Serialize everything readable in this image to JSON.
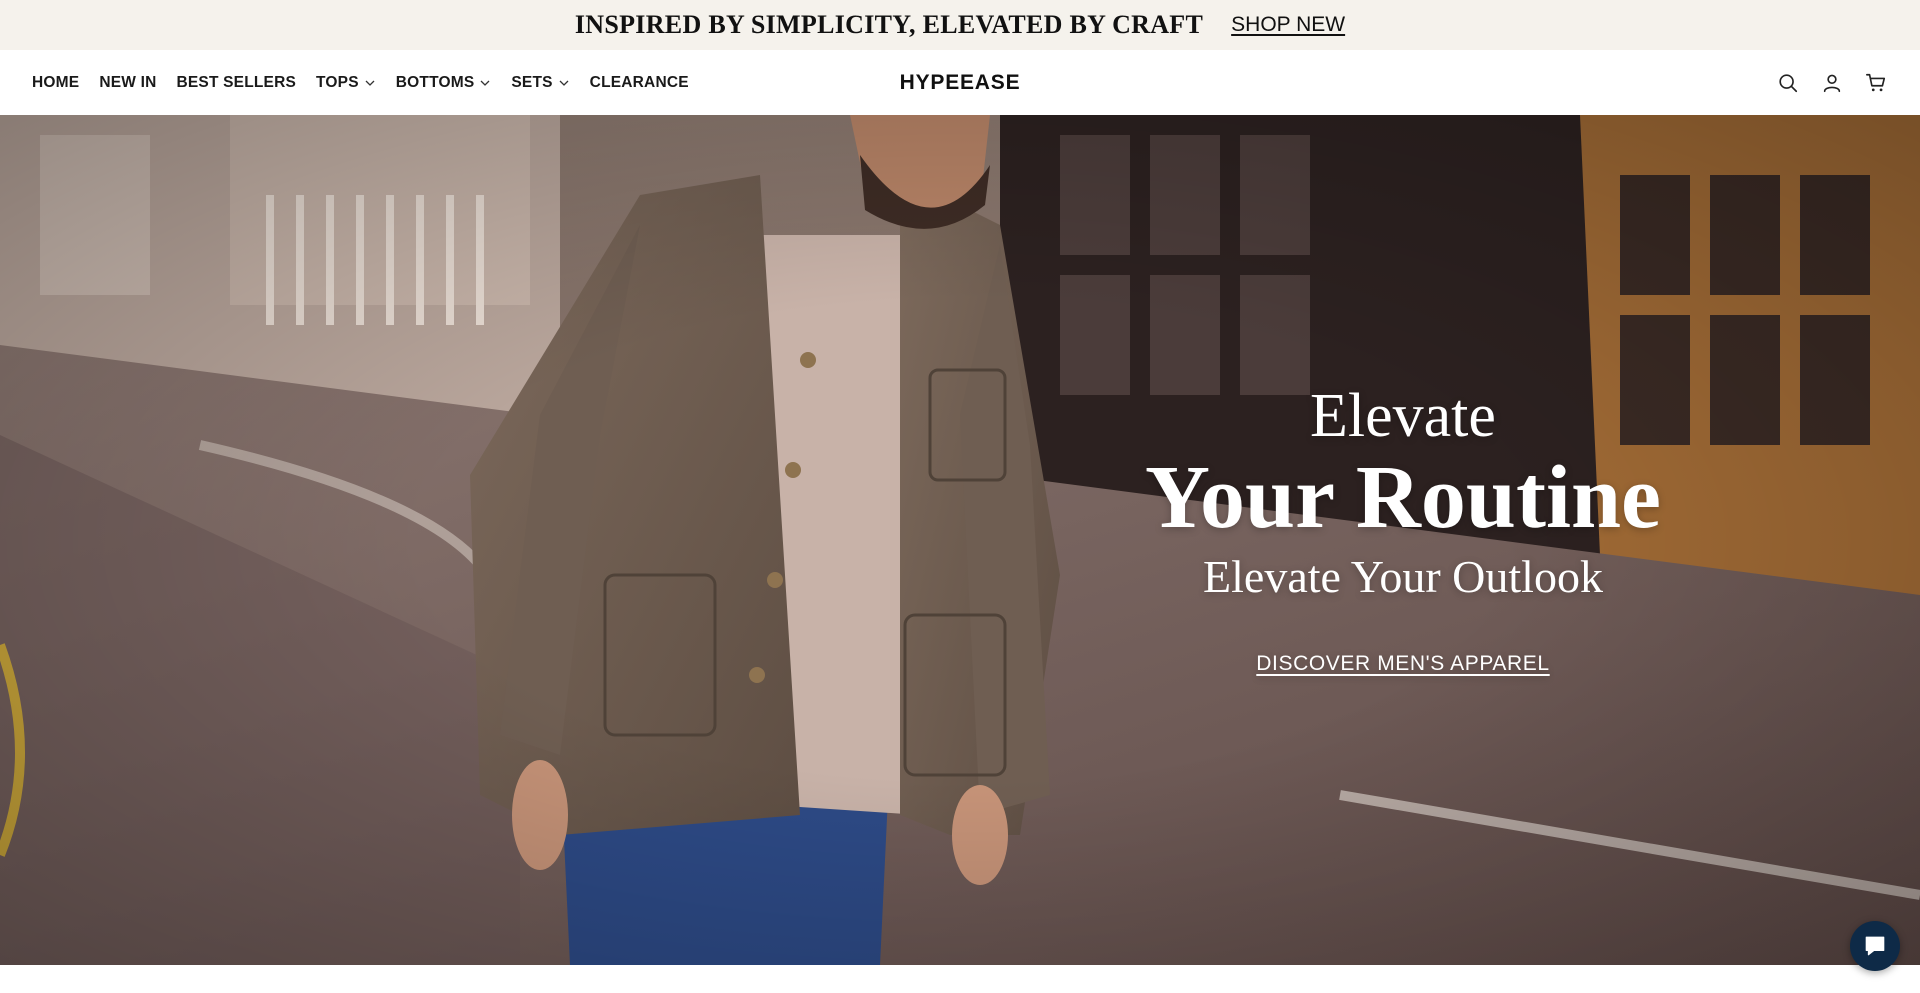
{
  "announcement": {
    "text": "INSPIRED BY SIMPLICITY, ELEVATED BY CRAFT",
    "link_label": "SHOP NEW"
  },
  "nav": {
    "items": [
      {
        "label": "HOME",
        "has_dropdown": false
      },
      {
        "label": "NEW IN",
        "has_dropdown": false
      },
      {
        "label": "BEST SELLERS",
        "has_dropdown": false
      },
      {
        "label": "TOPS",
        "has_dropdown": true
      },
      {
        "label": "BOTTOMS",
        "has_dropdown": true
      },
      {
        "label": "SETS",
        "has_dropdown": true
      },
      {
        "label": "CLEARANCE",
        "has_dropdown": false
      }
    ]
  },
  "brand": {
    "logo_text": "HYPEEASE"
  },
  "header_icons": [
    "search-icon",
    "account-icon",
    "cart-icon"
  ],
  "hero": {
    "eyebrow": "Elevate",
    "headline": "Your Routine",
    "subheadline": "Elevate Your Outlook",
    "cta_label": "DISCOVER MEN'S APPAREL"
  },
  "chat": {
    "icon": "chat-icon",
    "color": "#0e2a47"
  },
  "colors": {
    "announcement_bg": "#f5f2ec",
    "header_bg": "#ffffff",
    "hero_text": "#ffffff"
  }
}
